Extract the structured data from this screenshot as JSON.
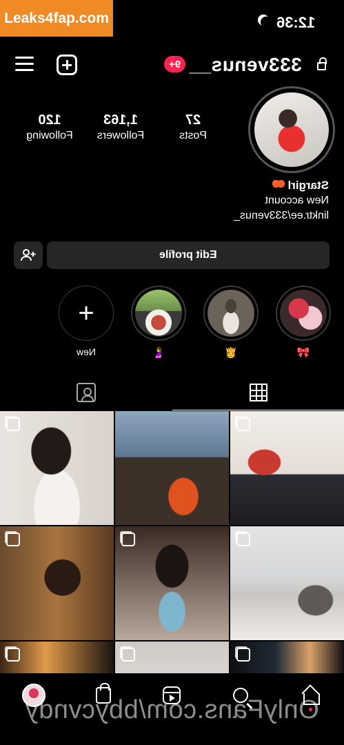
{
  "watermark_top": "Leaks4fap.com",
  "status_bar": {
    "time": "12:36",
    "moon_icon": "moon-icon"
  },
  "header": {
    "username": "333venus__",
    "notification_badge": "9+",
    "lock_icon": "lock-icon",
    "add_icon": "plus-square-icon",
    "menu_icon": "hamburger-menu-icon"
  },
  "profile": {
    "stats": [
      {
        "value": "27",
        "label": "Posts"
      },
      {
        "value": "1,163",
        "label": "Followers"
      },
      {
        "value": "120",
        "label": "Following"
      }
    ],
    "bio": {
      "name": "Stargirl",
      "lines": [
        "New account",
        "linktr.ee/333venus_"
      ]
    }
  },
  "actions": {
    "edit_profile": "Edit profile",
    "add_friend_icon": "add-person-icon"
  },
  "highlights": [
    {
      "caption": "🎀",
      "colors": [
        "#d8394a",
        "#f3c7cf"
      ]
    },
    {
      "caption": "👸",
      "colors": [
        "#cfc7c0",
        "#4a4038"
      ]
    },
    {
      "caption": "🤰",
      "colors": [
        "#9bc36e",
        "#c44a3a"
      ]
    },
    {
      "caption": "New"
    }
  ],
  "tabs": {
    "grid_icon": "grid-icon",
    "tagged_icon": "tagged-user-icon"
  },
  "posts": [
    {
      "colors": [
        "#e9e4df",
        "#221a17",
        "#d32c2c"
      ]
    },
    {
      "colors": [
        "#8fa6bd",
        "#3c3028",
        "#e0531f"
      ]
    },
    {
      "colors": [
        "#f1ede9",
        "#c93930",
        "#2b2b33"
      ]
    },
    {
      "colors": [
        "#6b4a2e",
        "#2a1a14",
        "#a8743e"
      ]
    },
    {
      "colors": [
        "#3a2a22",
        "#7fb6cf",
        "#b9a99c"
      ]
    },
    {
      "colors": [
        "#e2e4e6",
        "#c9c6c2",
        "#5f5a55"
      ]
    },
    {
      "colors": [
        "#3b2616",
        "#e29a4a",
        "#1a1410"
      ]
    },
    {
      "colors": [
        "#cfcac5",
        "#4a3d33",
        "#efece9"
      ]
    },
    {
      "colors": [
        "#1f2a35",
        "#d9a26a",
        "#0f0f12"
      ]
    }
  ],
  "bottom_nav": {
    "items": [
      "profile-avatar-icon",
      "shop-bag-icon",
      "reels-icon",
      "search-icon",
      "home-icon"
    ]
  },
  "watermark_bottom": "OnlyFans.com/bbycvndy"
}
